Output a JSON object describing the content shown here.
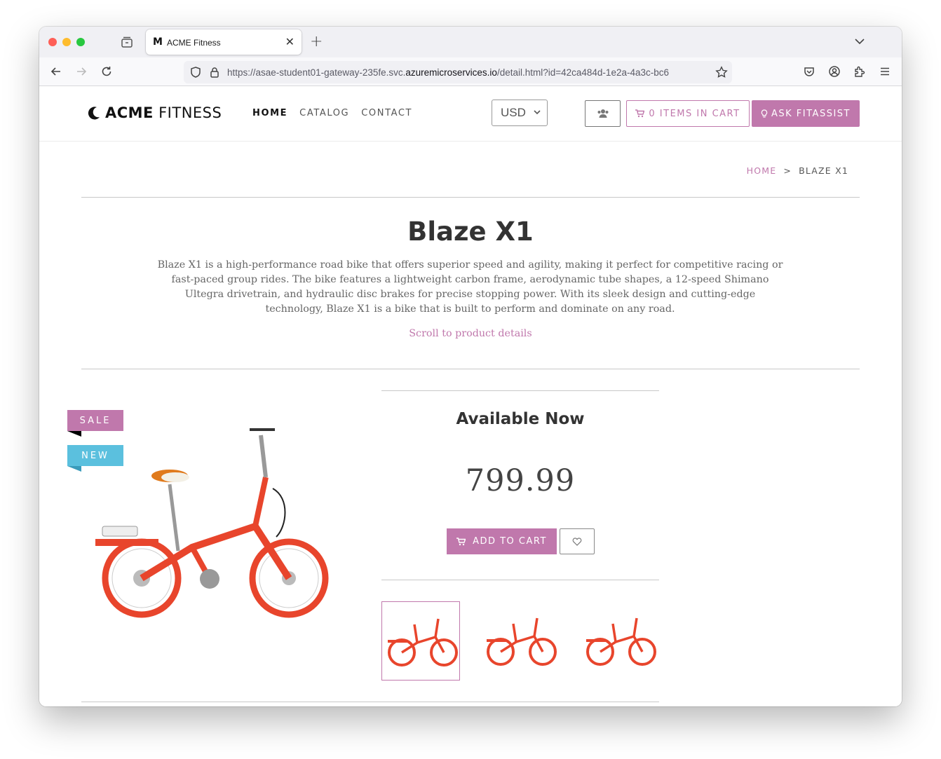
{
  "browser": {
    "tab_title": "ACME Fitness",
    "tab_favicon": "M",
    "url_prefix": "https://asae-student01-gateway-235fe.svc.",
    "url_domain": "azuremicroservices.io",
    "url_suffix": "/detail.html?id=42ca484d-1e2a-4a3c-bc6",
    "icons": [
      "tab-overview-icon",
      "back-icon",
      "forward-icon",
      "reload-icon",
      "shield-icon",
      "lock-icon",
      "bookmark-star-icon",
      "pocket-icon",
      "account-icon",
      "extensions-icon",
      "menu-icon",
      "tab-list-chevron-icon"
    ]
  },
  "header": {
    "logo_bold": "ACME",
    "logo_light": " FITNESS",
    "nav": [
      {
        "label": "HOME",
        "active": true
      },
      {
        "label": "CATALOG",
        "active": false
      },
      {
        "label": "CONTACT",
        "active": false
      }
    ],
    "currency": "USD",
    "cart_label": "0 ITEMS IN CART",
    "ask_label": "ASK FITASSIST"
  },
  "breadcrumb": {
    "home": "HOME",
    "separator": ">",
    "current": "BLAZE X1"
  },
  "product": {
    "title": "Blaze X1",
    "description": "Blaze X1 is a high-performance road bike that offers superior speed and agility, making it perfect for competitive racing or fast-paced group rides. The bike features a lightweight carbon frame, aerodynamic tube shapes, a 12-speed Shimano Ultegra drivetrain, and hydraulic disc brakes for precise stopping power. With its sleek design and cutting-edge technology, Blaze X1 is a bike that is built to perform and dominate on any road.",
    "scroll_link": "Scroll to product details",
    "badges": {
      "sale": "SALE",
      "new": "NEW"
    },
    "availability": "Available Now",
    "price": "799.99",
    "add_to_cart": "ADD TO CART",
    "thumbnails": 3,
    "selected_thumbnail": 1
  },
  "colors": {
    "accent": "#c078ac",
    "new_badge": "#5bc0de",
    "bike_red": "#e8452c"
  }
}
